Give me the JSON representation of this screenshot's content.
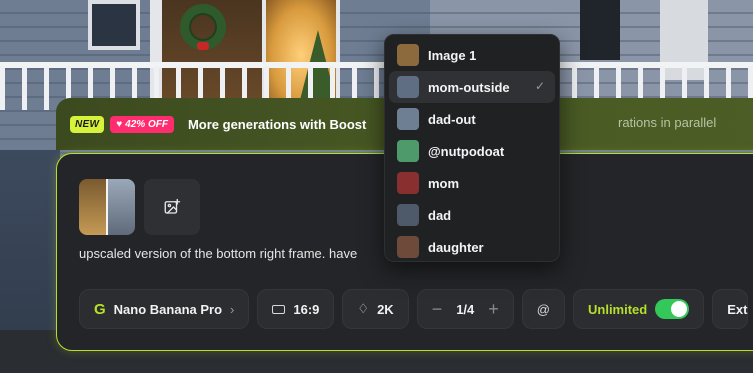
{
  "promo": {
    "new_badge": "NEW",
    "discount_badge": "42% OFF",
    "title": "More generations with Boost",
    "subtitle_fragment": "rations in parallel"
  },
  "prompt": {
    "text": "upscaled version of the bottom right frame. have"
  },
  "toolbar": {
    "model": "Nano Banana Pro",
    "model_logo": "G",
    "aspect_ratio": "16:9",
    "resolution": "2K",
    "count": "1/4",
    "unlimited_label": "Unlimited",
    "unlimited_enabled": true,
    "extra_label": "Ext"
  },
  "mention_menu": {
    "items": [
      {
        "label": "Image 1",
        "selected": false,
        "thumb_color": "#8d6a3e"
      },
      {
        "label": "mom-outside",
        "selected": true,
        "thumb_color": "#5f6e82"
      },
      {
        "label": "dad-out",
        "selected": false,
        "thumb_color": "#6f7f93"
      },
      {
        "label": "@nutpodoat",
        "selected": false,
        "thumb_color": "#4f9a6a"
      },
      {
        "label": "mom",
        "selected": false,
        "thumb_color": "#8a2f2f"
      },
      {
        "label": "dad",
        "selected": false,
        "thumb_color": "#4e5a6a"
      },
      {
        "label": "daughter",
        "selected": false,
        "thumb_color": "#6e4a3a"
      }
    ]
  },
  "colors": {
    "accent": "#b8e02a",
    "discount": "#ff2d6f",
    "toggle_on": "#34c759"
  }
}
